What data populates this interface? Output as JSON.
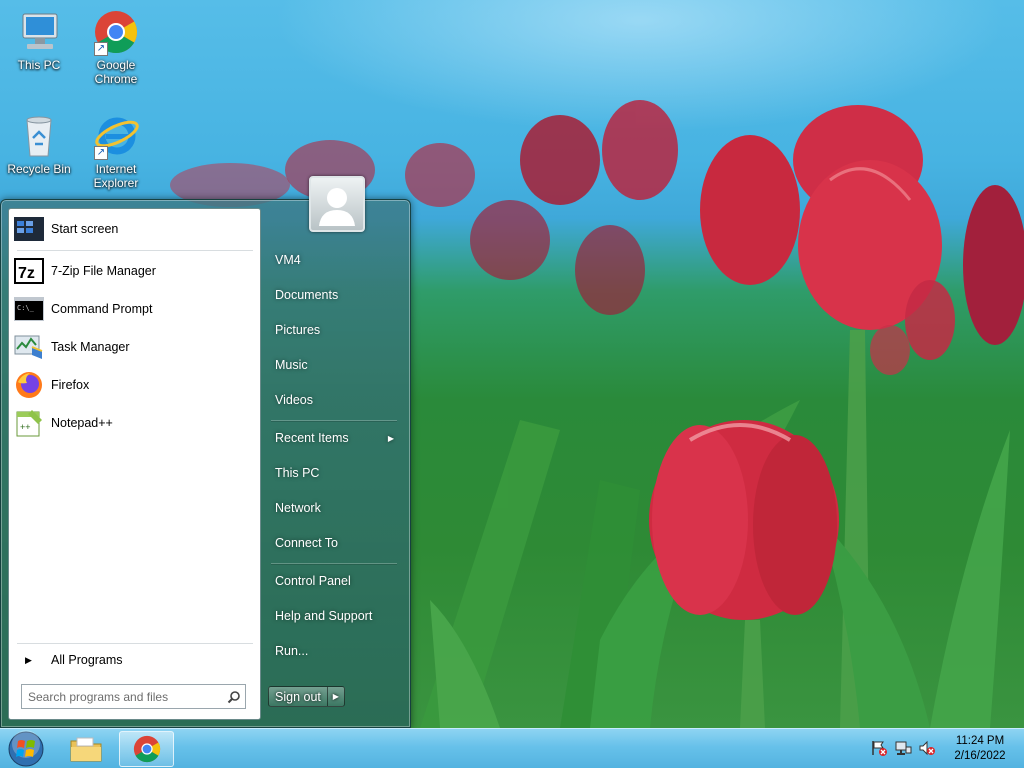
{
  "desktop": {
    "icons": [
      {
        "label_line1": "This PC",
        "label_line2": ""
      },
      {
        "label_line1": "Google",
        "label_line2": "Chrome"
      },
      {
        "label_line1": "Recycle Bin",
        "label_line2": ""
      },
      {
        "label_line1": "Internet",
        "label_line2": "Explorer"
      }
    ]
  },
  "start_menu": {
    "pinned": [
      {
        "label": "Start screen",
        "icon": "start-screen-icon"
      },
      {
        "label": "7-Zip File Manager",
        "icon": "7zip-icon"
      },
      {
        "label": "Command Prompt",
        "icon": "command-prompt-icon"
      },
      {
        "label": "Task Manager",
        "icon": "task-manager-icon"
      },
      {
        "label": "Firefox",
        "icon": "firefox-icon"
      },
      {
        "label": "Notepad++",
        "icon": "notepad-plus-plus-icon"
      }
    ],
    "all_programs": "All Programs",
    "search_placeholder": "Search programs and files",
    "right": {
      "user": "VM4",
      "documents": "Documents",
      "pictures": "Pictures",
      "music": "Music",
      "videos": "Videos",
      "recent_items": "Recent Items",
      "this_pc": "This PC",
      "network": "Network",
      "connect_to": "Connect To",
      "control_panel": "Control Panel",
      "help_support": "Help and Support",
      "run": "Run..."
    },
    "sign_out": "Sign out"
  },
  "taskbar": {
    "time": "11:24 PM",
    "date": "2/16/2022"
  },
  "colors": {
    "taskbar": "#67c1ea",
    "menu_glass": "#3c7882",
    "sky": "#56bde8"
  }
}
